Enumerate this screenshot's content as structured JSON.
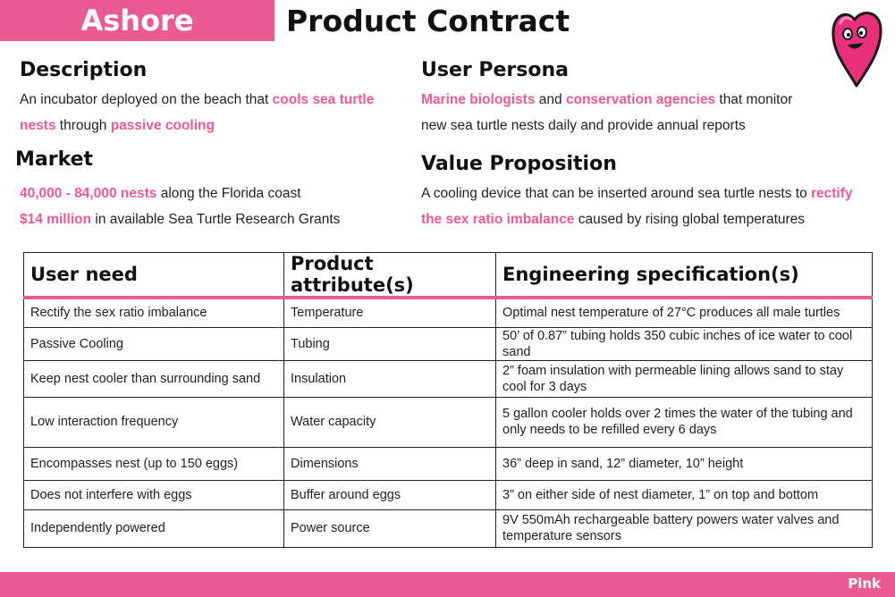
{
  "brand": "Ashore",
  "title": "Product Contract",
  "description": {
    "heading": "Description",
    "line1_a": "An incubator deployed on the beach that ",
    "line1_hl": "cools sea turtle",
    "line2_hl": "nests",
    "line2_b": " through ",
    "line2_hl2": "passive cooling"
  },
  "persona": {
    "heading": "User Persona",
    "hl1": "Marine biologists",
    "mid": " and ",
    "hl2": "conservation agencies",
    "line1_end": " that monitor",
    "line2": "new sea turtle nests daily and provide annual reports"
  },
  "market": {
    "heading": "Market",
    "hl1": "40,000 - 84,000 nests",
    "line1_end": " along the Florida coast",
    "hl2": "$14 million",
    "line2_end": " in available Sea Turtle Research Grants"
  },
  "value": {
    "heading": "Value Proposition",
    "line1_a": "A cooling device that can be inserted around sea turtle nests to ",
    "line1_hl": "rectify",
    "line2_hl": "the sex ratio imbalance",
    "line2_end": " caused by rising global temperatures"
  },
  "table": {
    "headers": [
      "User need",
      "Product attribute(s)",
      "Engineering specification(s)"
    ],
    "rows": [
      [
        "Rectify the sex ratio imbalance",
        "Temperature",
        "Optimal nest temperature of 27°C produces all male turtles"
      ],
      [
        "Passive Cooling",
        "Tubing",
        "50’ of 0.87” tubing holds 350 cubic inches of ice water to cool sand"
      ],
      [
        "Keep nest cooler than surrounding sand",
        "Insulation",
        "2” foam insulation with permeable lining allows sand to stay cool for 3 days"
      ],
      [
        "Low interaction frequency",
        "Water capacity",
        "5 gallon cooler holds over 2 times the water of the tubing and only needs to be refilled every 6 days"
      ],
      [
        "Encompasses nest (up to 150 eggs)",
        "Dimensions",
        "36” deep in sand, 12” diameter, 10” height"
      ],
      [
        "Does not interfere with eggs",
        "Buffer around eggs",
        "3” on either side of nest diameter, 1” on top and bottom"
      ],
      [
        "Independently powered",
        "Power source",
        "9V 550mAh rechargeable battery powers water valves and temperature sensors"
      ]
    ]
  },
  "footer": {
    "label": "Pink"
  },
  "colors": {
    "accent": "#ec5a92",
    "text": "#222222"
  },
  "icons": {
    "mascot": "pink-heart-mascot-icon"
  }
}
